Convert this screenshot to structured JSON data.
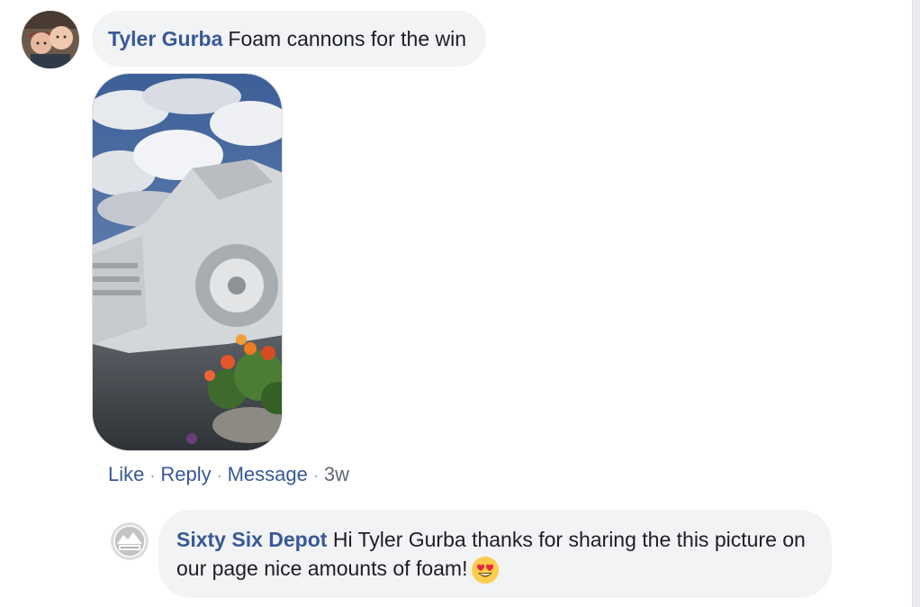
{
  "comments": [
    {
      "author": "Tyler Gurba",
      "text": "Foam cannons for the win",
      "avatar_icon": "profile-photo-two-people",
      "attachment": "photo-foam-covered-pickup-truck",
      "actions": {
        "like": "Like",
        "reply": "Reply",
        "message": "Message",
        "time": "3w"
      }
    }
  ],
  "replies": [
    {
      "author": "Sixty Six Depot",
      "text": "Hi Tyler Gurba thanks for sharing the this picture on our page nice amounts of foam!",
      "emoji": "smiling-face-with-heart-eyes-emoji",
      "avatar_icon": "sixty-six-depot-logo"
    }
  ],
  "separator": "·",
  "colors": {
    "link": "#385898",
    "bubble": "#f2f3f5",
    "meta": "#606770"
  }
}
